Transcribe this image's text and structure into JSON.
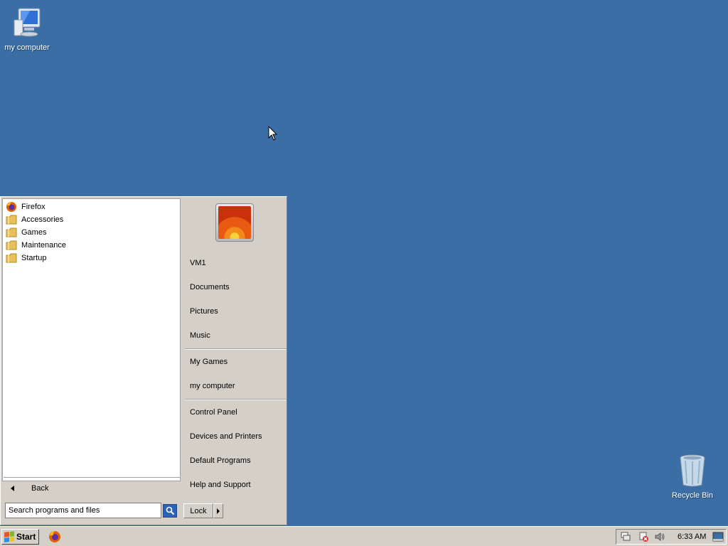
{
  "desktop": {
    "icons": [
      {
        "label": "my computer",
        "icon": "computer-icon"
      },
      {
        "label": "Recycle Bin",
        "icon": "recycle-bin-icon"
      }
    ],
    "background_color": "#3a6ea5"
  },
  "start_menu": {
    "programs": [
      {
        "label": "Firefox",
        "icon": "firefox-icon"
      },
      {
        "label": "Accessories",
        "icon": "folder-icon"
      },
      {
        "label": "Games",
        "icon": "folder-icon"
      },
      {
        "label": "Maintenance",
        "icon": "folder-icon"
      },
      {
        "label": "Startup",
        "icon": "folder-icon"
      }
    ],
    "back_label": "Back",
    "search": {
      "placeholder": "Search programs and files",
      "value": ""
    },
    "right_items": [
      {
        "label": "VM1"
      },
      {
        "label": "Documents"
      },
      {
        "label": "Pictures"
      },
      {
        "label": "Music"
      },
      {
        "label": "My Games"
      },
      {
        "label": "my computer"
      },
      {
        "label": "Control Panel"
      },
      {
        "label": "Devices and Printers"
      },
      {
        "label": "Default Programs"
      },
      {
        "label": "Help and Support"
      }
    ],
    "lock_label": "Lock"
  },
  "taskbar": {
    "start_label": "Start",
    "clock": "6:33 AM",
    "tray_icons": [
      "network-icon",
      "action-center-icon",
      "volume-icon"
    ]
  }
}
